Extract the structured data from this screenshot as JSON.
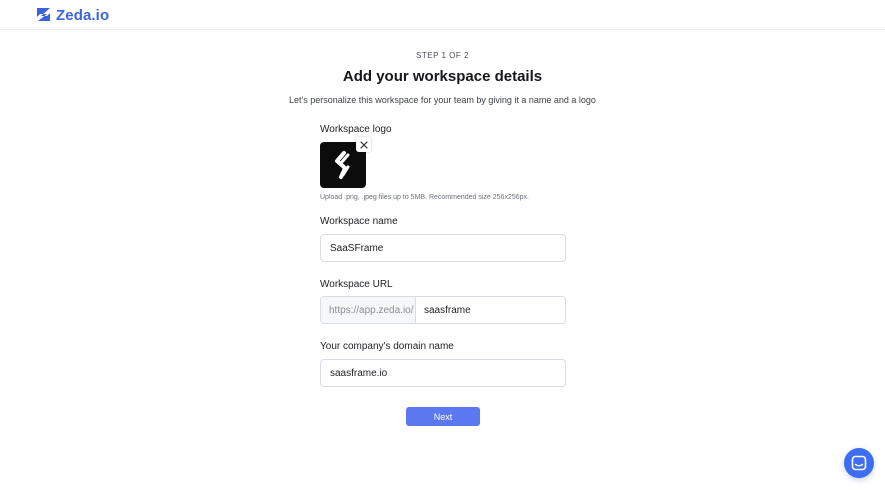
{
  "brand": {
    "name": "Zeda.io",
    "color": "#3a63e0"
  },
  "header": {
    "step": "STEP 1 OF 2",
    "title": "Add your workspace details",
    "subtitle": "Let's personalize this workspace for your team by giving it a name and a logo"
  },
  "logo_section": {
    "label": "Workspace logo",
    "remove_icon": "close-icon",
    "hint": "Upload .png, .jpeg files up to 5MB. Recommended size 256x256px."
  },
  "workspace_name": {
    "label": "Workspace name",
    "value": "SaaSFrame"
  },
  "workspace_url": {
    "label": "Workspace URL",
    "prefix": "https://app.zeda.io/",
    "value": "saasframe"
  },
  "domain": {
    "label": "Your company's domain name",
    "value": "saasframe.io"
  },
  "actions": {
    "next_label": "Next",
    "next_color": "#5b78f0"
  },
  "chat": {
    "icon": "chat-icon",
    "color": "#3d6df2"
  }
}
